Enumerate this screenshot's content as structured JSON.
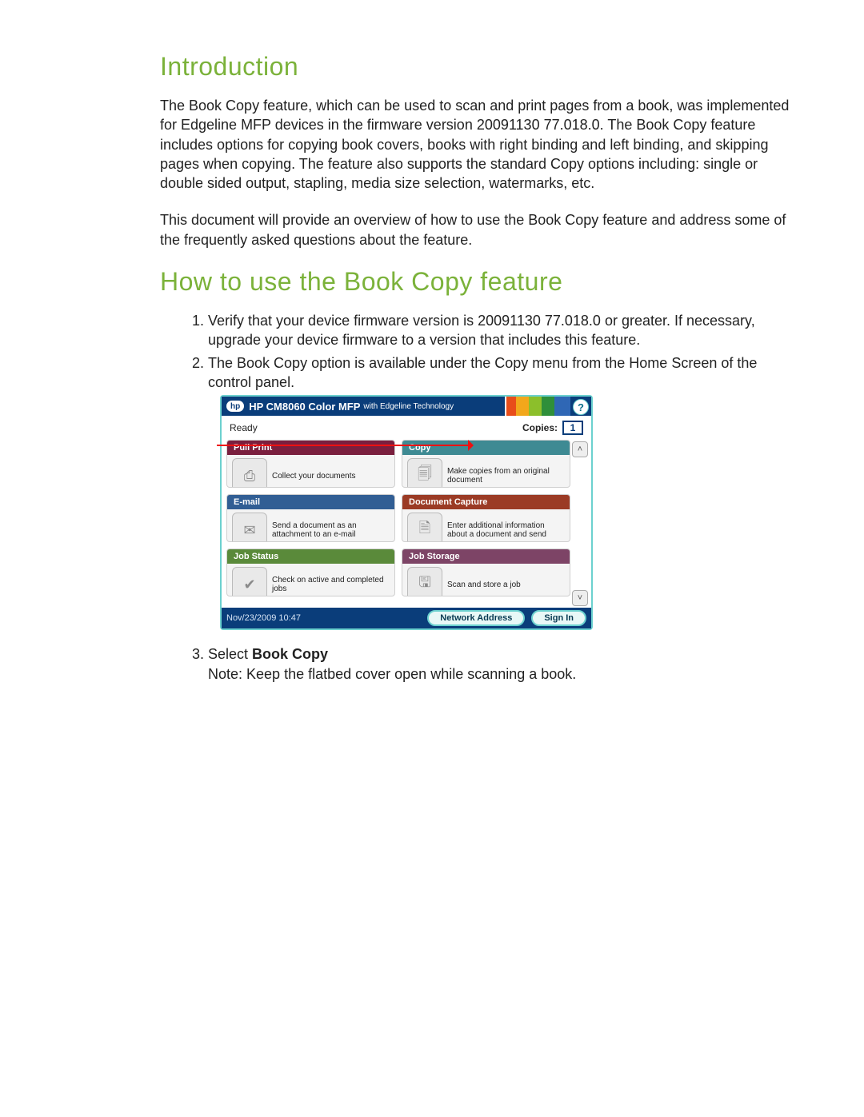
{
  "doc": {
    "heading_intro": "Introduction",
    "intro_p1": "The Book Copy feature, which can be used to scan and print pages from a book, was implemented for Edgeline MFP devices in the firmware version 20091130 77.018.0. The Book Copy feature includes options for copying book covers, books with right binding and left binding, and skipping pages when copying.  The feature also supports the standard Copy options including: single or double sided output, stapling, media size selection, watermarks, etc.",
    "intro_p2": "This document will provide an overview of how to use the Book Copy feature and address some of the frequently asked questions about the feature.",
    "heading_howto": "How to use the Book Copy feature",
    "steps": [
      "Verify that your device firmware version is 20091130 77.018.0 or greater.  If necessary, upgrade your device firmware to a version that includes this feature.",
      "The Book Copy option is available under the Copy menu from the Home Screen of the control panel."
    ],
    "step3_prefix": "Select ",
    "step3_bold": "Book Copy",
    "step3_note": "Note: Keep the flatbed cover open while scanning a book."
  },
  "panel": {
    "brand_badge": "hp",
    "title_main": "HP CM8060 Color MFP",
    "title_sub": "with Edgeline Technology",
    "help": "?",
    "status": "Ready",
    "copies_label": "Copies:",
    "copies_value": "1",
    "tiles": {
      "pull": {
        "title": "Pull Print",
        "desc": "Collect your documents",
        "icon": "⎙"
      },
      "copy": {
        "title": "Copy",
        "desc": "Make copies from an original document",
        "icon": "🗐"
      },
      "email": {
        "title": "E-mail",
        "desc": "Send a document as an attachment to an e-mail",
        "icon": "✉"
      },
      "doccap": {
        "title": "Document Capture",
        "desc": "Enter additional information about a document and send",
        "icon": "🗎"
      },
      "jobstat": {
        "title": "Job Status",
        "desc": "Check on active and completed jobs",
        "icon": "✔"
      },
      "jobstor": {
        "title": "Job Storage",
        "desc": "Scan and store a job",
        "icon": "🖫"
      }
    },
    "scroll_up": "˄",
    "scroll_down": "˅",
    "footer_time": "Nov/23/2009 10:47",
    "footer_net": "Network Address",
    "footer_signin": "Sign In"
  }
}
